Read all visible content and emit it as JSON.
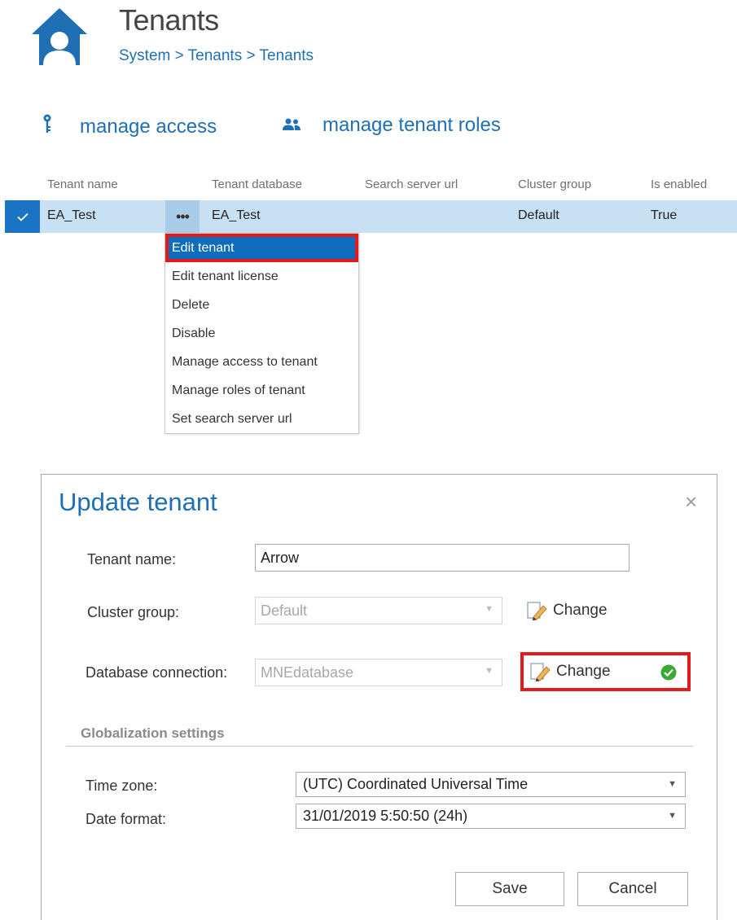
{
  "header": {
    "title": "Tenants",
    "breadcrumb": "System > Tenants > Tenants",
    "icon": "home-user-icon",
    "accent_color": "#1f6fb5"
  },
  "actions": {
    "manage_access": "manage access",
    "manage_access_icon": "key-icon",
    "manage_roles": "manage tenant roles",
    "manage_roles_icon": "users-icon"
  },
  "table": {
    "columns": [
      "Tenant name",
      "Tenant database",
      "Search server url",
      "Cluster group",
      "Is enabled"
    ],
    "rows": [
      {
        "tenant_name": "EA_Test",
        "more_label": "•••",
        "tenant_database": "EA_Test",
        "search_server_url": "",
        "cluster_group": "Default",
        "is_enabled": "True",
        "selected": true
      }
    ]
  },
  "context_menu": {
    "items": [
      "Edit tenant",
      "Edit tenant license",
      "Delete",
      "Disable",
      "Manage access to tenant",
      "Manage roles of tenant",
      "Set search server url"
    ],
    "active_index": 0
  },
  "dialog": {
    "title": "Update tenant",
    "close_glyph": "×",
    "tenant_name_label": "Tenant name:",
    "tenant_name_value": "Arrow",
    "cluster_group_label": "Cluster group:",
    "cluster_group_value": "Default",
    "change_label": "Change",
    "database_connection_label": "Database connection:",
    "database_connection_value": "MNEdatabase",
    "section_title": "Globalization settings",
    "time_zone_label": "Time zone:",
    "time_zone_value": "(UTC) Coordinated Universal Time",
    "date_format_label": "Date format:",
    "date_format_value": "31/01/2019 5:50:50 (24h)",
    "save_label": "Save",
    "cancel_label": "Cancel"
  },
  "colors": {
    "selection_row": "#c7e0f4",
    "selection_check": "#1b73c3",
    "menu_active": "#0f6cbd",
    "highlight_border": "#e3191c",
    "success": "#3aaa35"
  }
}
